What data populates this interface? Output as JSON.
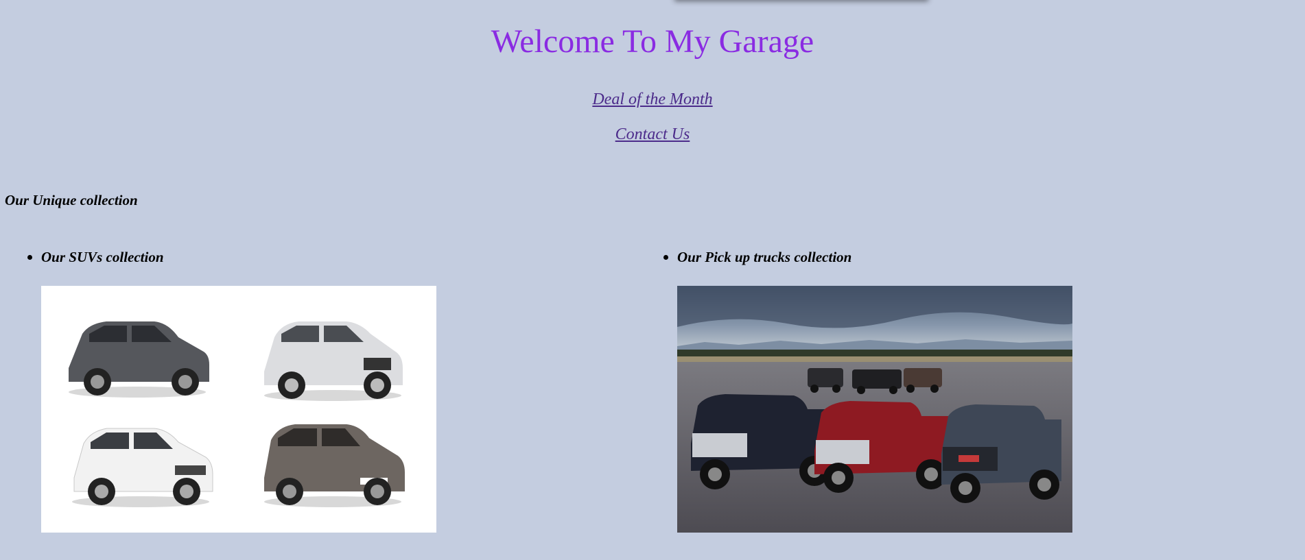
{
  "header": {
    "title": "Welcome To My Garage"
  },
  "nav": {
    "deal_label": "Deal of the Month",
    "contact_label": "Contact Us"
  },
  "collection": {
    "heading": "Our Unique collection",
    "suvs": {
      "title": "Our SUVs collection",
      "image_alt": "Four SUVs on white background"
    },
    "trucks": {
      "title": "Our Pick up trucks collection",
      "image_alt": "Six pickup trucks on a tarmac"
    }
  },
  "colors": {
    "background": "#c4cde0",
    "title": "#8a2be2",
    "link": "#4b2a8a"
  }
}
